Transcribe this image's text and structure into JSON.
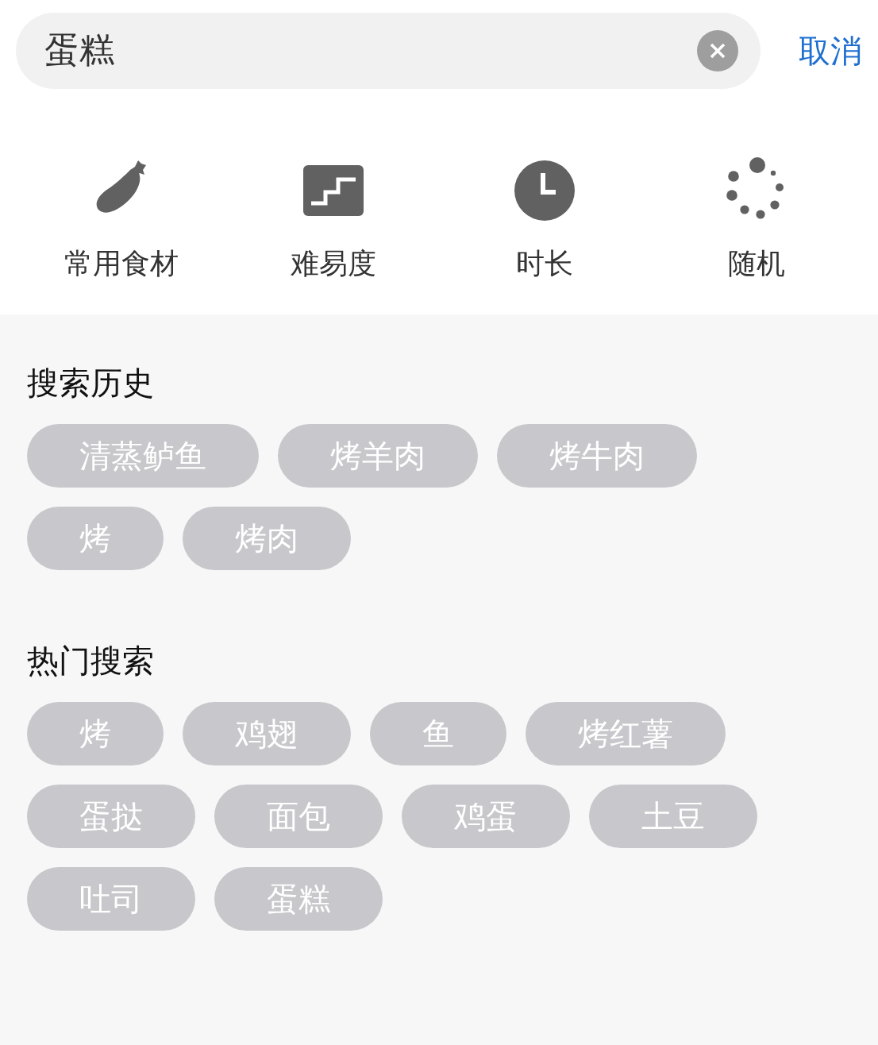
{
  "search": {
    "value": "蛋糕",
    "cancel": "取消"
  },
  "categories": [
    {
      "kind": "eggplant",
      "label": "常用食材"
    },
    {
      "kind": "stairs",
      "label": "难易度"
    },
    {
      "kind": "clock",
      "label": "时长"
    },
    {
      "kind": "spinner",
      "label": "随机"
    }
  ],
  "sections": [
    {
      "title": "搜索历史",
      "tags": [
        "清蒸鲈鱼",
        "烤羊肉",
        "烤牛肉",
        "烤",
        "烤肉"
      ]
    },
    {
      "title": "热门搜索",
      "tags": [
        "烤",
        "鸡翅",
        "鱼",
        "烤红薯",
        "蛋挞",
        "面包",
        "鸡蛋",
        "土豆",
        "吐司",
        "蛋糕"
      ]
    }
  ]
}
